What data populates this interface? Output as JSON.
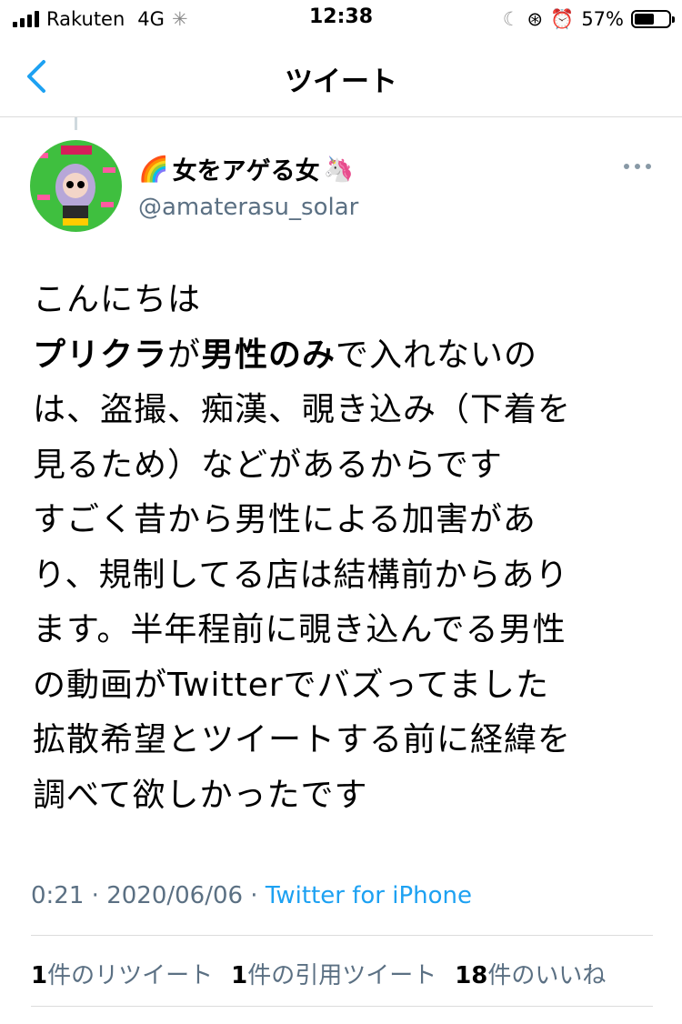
{
  "status_bar": {
    "carrier": "Rakuten",
    "network": "4G",
    "time": "12:38",
    "battery_percent": "57%",
    "battery_level": 0.57
  },
  "nav": {
    "title": "ツイート"
  },
  "tweet": {
    "author": {
      "name_prefix_emoji": "🌈",
      "name": "女をアゲる女",
      "name_suffix_emoji": "🦄",
      "handle": "@amaterasu_solar"
    },
    "text_lines": [
      [
        {
          "t": "こんにちは",
          "b": false
        }
      ],
      [
        {
          "t": "プリクラ",
          "b": true
        },
        {
          "t": "が",
          "b": false
        },
        {
          "t": "男性のみ",
          "b": true
        },
        {
          "t": "で入れないの",
          "b": false
        }
      ],
      [
        {
          "t": "は、盗撮、痴漢、覗き込み（下着を",
          "b": false
        }
      ],
      [
        {
          "t": "見るため）などがあるからです",
          "b": false
        }
      ],
      [
        {
          "t": "すごく昔から男性による加害があ",
          "b": false
        }
      ],
      [
        {
          "t": "り、規制してる店は結構前からあり",
          "b": false
        }
      ],
      [
        {
          "t": "ます。半年程前に覗き込んでる男性",
          "b": false
        }
      ],
      [
        {
          "t": "の動画がTwitterでバズってました",
          "b": false
        }
      ],
      [
        {
          "t": "拡散希望とツイートする前に経緯を",
          "b": false
        }
      ],
      [
        {
          "t": "調べて欲しかったです",
          "b": false
        }
      ]
    ],
    "time": "0:21",
    "date": "2020/06/06",
    "separator": " · ",
    "source": "Twitter for iPhone",
    "retweets": {
      "count": "1",
      "label": "件のリツイート"
    },
    "quotes": {
      "count": "1",
      "label": "件の引用ツイート"
    },
    "likes": {
      "count": "18",
      "label": "件のいいね"
    }
  },
  "colors": {
    "accent": "#1da1f2",
    "secondary_text": "#5b7083",
    "back_arrow": "#1da1f2",
    "avatar_bg": "#3fbf3f"
  }
}
